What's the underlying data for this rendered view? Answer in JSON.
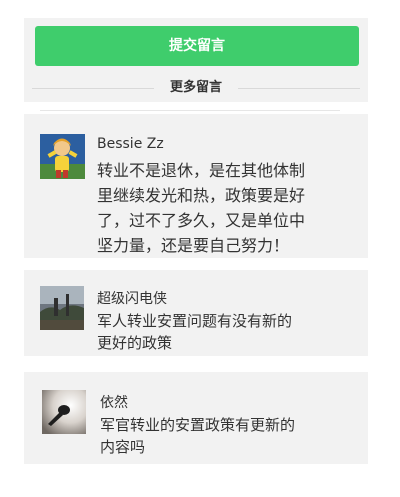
{
  "actions": {
    "submit_label": "提交留言",
    "more_label": "更多留言"
  },
  "comments": [
    {
      "user": "Bessie Zz",
      "lines": [
        "转业不是退休，是在其他体制",
        "里继续发光和热，政策要是好",
        "了，过不了多久，又是单位中",
        "坚力量，还是要自己努力！"
      ]
    },
    {
      "user": "超级闪电侠",
      "lines": [
        "军人转业安置问题有没有新的",
        "更好的政策"
      ]
    },
    {
      "user": "依然",
      "lines": [
        "军官转业的安置政策有更新的",
        "内容吗"
      ]
    }
  ]
}
